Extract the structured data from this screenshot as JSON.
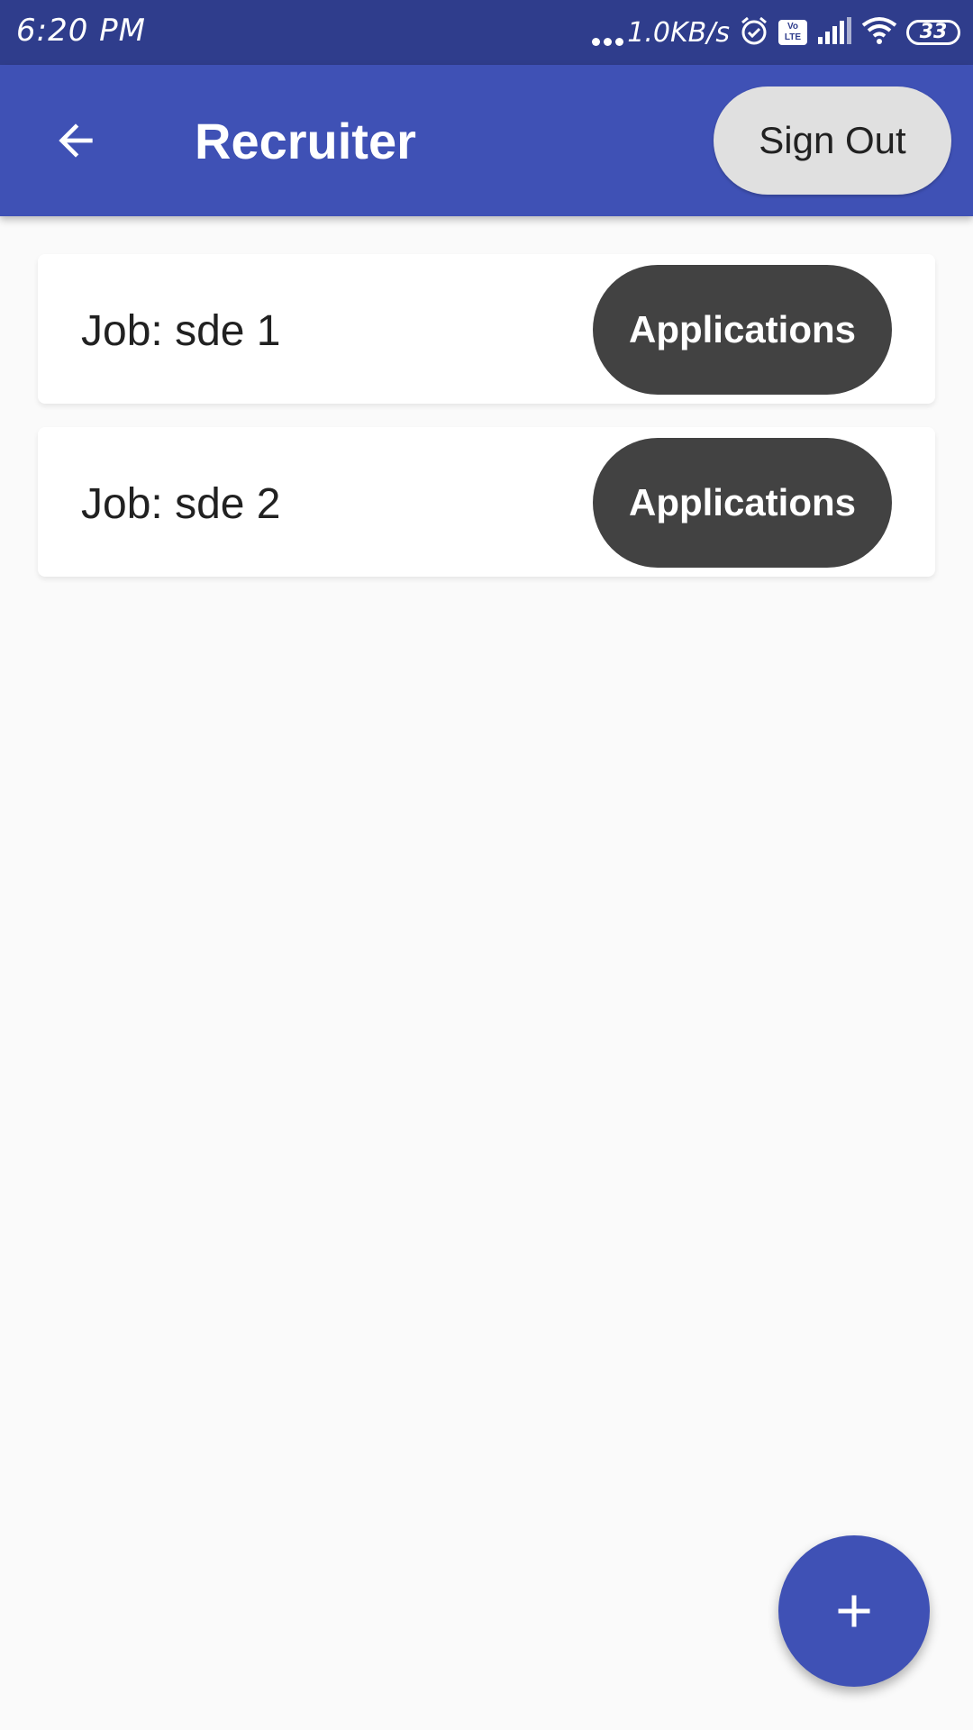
{
  "status_bar": {
    "time": "6:20 PM",
    "network_speed": "1.0KB/s",
    "volte_label": "Vo LTE",
    "battery_level": "33",
    "icons": [
      "alarm-icon",
      "volte-icon",
      "signal-icon",
      "wifi-icon",
      "battery-icon"
    ]
  },
  "app_bar": {
    "title": "Recruiter",
    "back_icon": "arrow-back-icon",
    "sign_out_label": "Sign Out"
  },
  "jobs": [
    {
      "title": "Job: sde 1",
      "button_label": "Applications"
    },
    {
      "title": "Job: sde 2",
      "button_label": "Applications"
    }
  ],
  "fab": {
    "icon": "plus-icon"
  },
  "colors": {
    "status_bar": "#2f3d8c",
    "app_bar": "#3f51b5",
    "sign_out_bg": "#e0e0e0",
    "applications_bg": "#424242",
    "background": "#fafafa"
  }
}
